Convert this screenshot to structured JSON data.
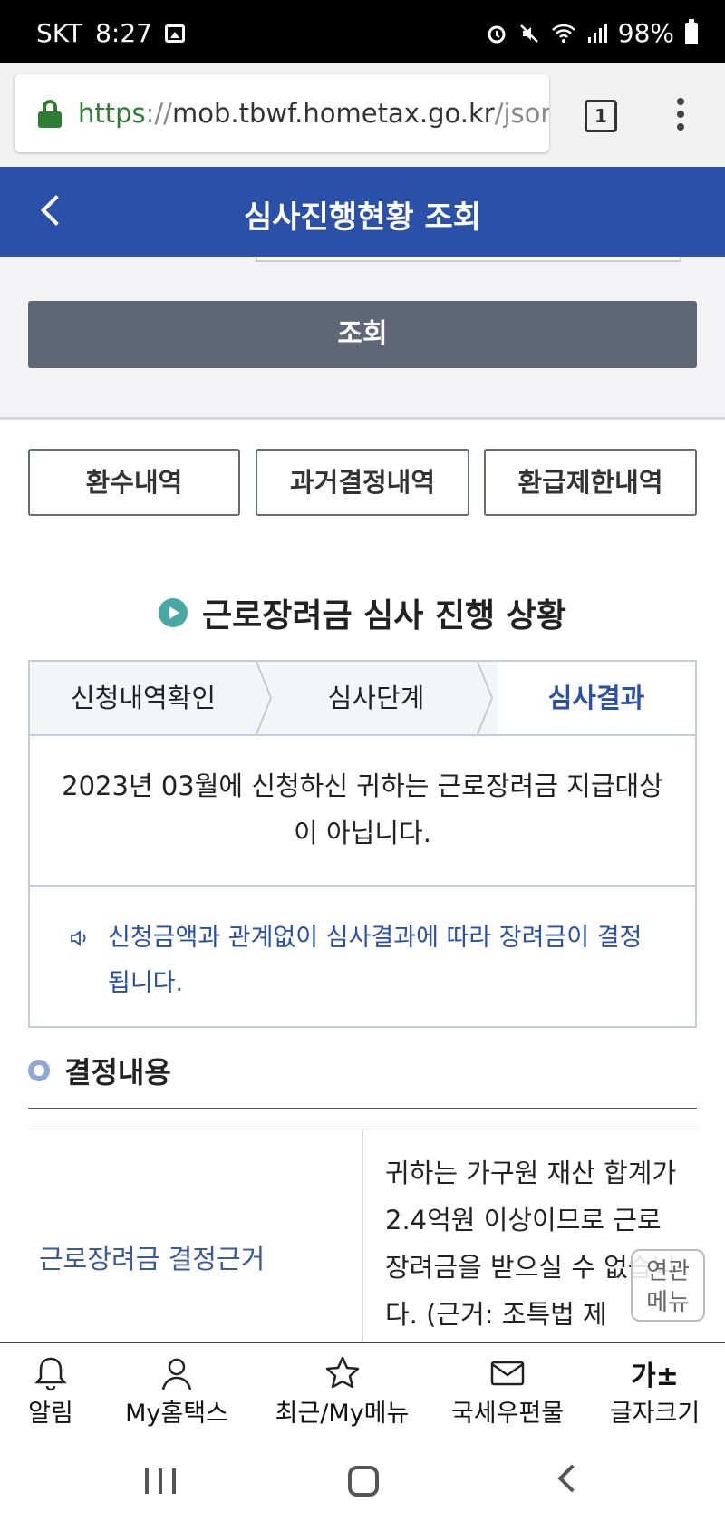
{
  "status_bar": {
    "carrier": "SKT",
    "time": "8:27",
    "battery": "98%",
    "icons": [
      "image-icon",
      "alarm-icon",
      "mute-icon",
      "wifi-icon",
      "signal-icon",
      "battery-icon"
    ]
  },
  "browser": {
    "url_scheme": "https",
    "url_sep": "://",
    "url_host": "mob.tbwf.hometax.go.kr",
    "url_path": "/json",
    "tab_count": "1",
    "scheme_color": "#2e7d32"
  },
  "header": {
    "title": "심사진행현황 조회",
    "bg_color": "#2b50a8"
  },
  "search": {
    "query_button": "조회"
  },
  "tabs": [
    {
      "label": "환수내역"
    },
    {
      "label": "과거결정내역"
    },
    {
      "label": "환급제한내역"
    }
  ],
  "section": {
    "title": "근로장려금 심사 진행 상황"
  },
  "steps": [
    {
      "label": "신청내역확인",
      "active": false
    },
    {
      "label": "심사단계",
      "active": false
    },
    {
      "label": "심사결과",
      "active": true
    }
  ],
  "result": {
    "message": "2023년 03월에 신청하신 귀하는 근로장려금 지급대상이 아닙니다."
  },
  "notice": {
    "text": "신청금액과 관계없이 심사결과에 따라 장려금이 결정됩니다."
  },
  "decision": {
    "title": "결정내용",
    "row_label": "근로장려금 결정근거",
    "row_value": "귀하는 가구원 재산 합계가 2.4억원 이상이므로 근로장려금을 받으실 수 없습니다. (근거: 조특법 제"
  },
  "float_menu": {
    "line1": "연관",
    "line2": "메뉴"
  },
  "bottom_nav": [
    {
      "label": "알림",
      "icon": "bell-icon"
    },
    {
      "label": "My홈택스",
      "icon": "user-icon"
    },
    {
      "label": "최근/My메뉴",
      "icon": "star-icon"
    },
    {
      "label": "국세우편물",
      "icon": "mail-icon"
    },
    {
      "label": "글자크기",
      "icon": "font-size-icon",
      "glyph": "가±"
    }
  ]
}
